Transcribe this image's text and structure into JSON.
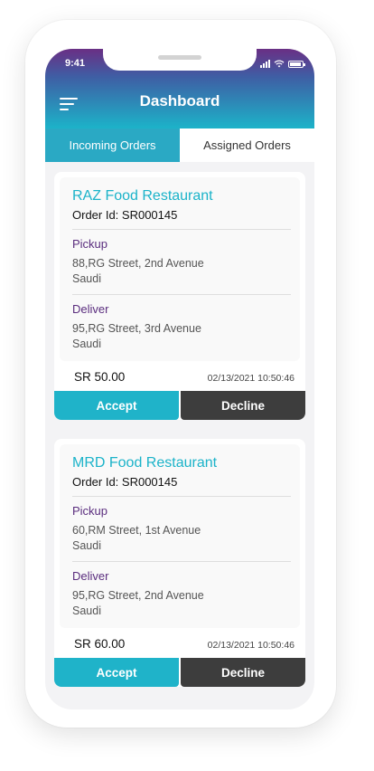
{
  "status_bar": {
    "time": "9:41"
  },
  "header": {
    "title": "Dashboard"
  },
  "tabs": [
    {
      "label": "Incoming Orders",
      "active": true
    },
    {
      "label": "Assigned Orders",
      "active": false
    }
  ],
  "orders": [
    {
      "restaurant": "RAZ Food Restaurant",
      "order_id": "Order Id: SR000145",
      "pickup_label": "Pickup",
      "pickup_line1": "88,RG Street, 2nd Avenue",
      "pickup_line2": "Saudi",
      "deliver_label": "Deliver",
      "deliver_line1": "95,RG Street, 3rd Avenue",
      "deliver_line2": "Saudi",
      "price": "SR 50.00",
      "datetime": "02/13/2021  10:50:46",
      "accept_label": "Accept",
      "decline_label": "Decline"
    },
    {
      "restaurant": "MRD Food Restaurant",
      "order_id": "Order Id: SR000145",
      "pickup_label": "Pickup",
      "pickup_line1": "60,RM Street, 1st Avenue",
      "pickup_line2": "Saudi",
      "deliver_label": "Deliver",
      "deliver_line1": "95,RG Street, 2nd Avenue",
      "deliver_line2": "Saudi",
      "price": "SR 60.00",
      "datetime": "02/13/2021  10:50:46",
      "accept_label": "Accept",
      "decline_label": "Decline"
    }
  ],
  "colors": {
    "accent": "#1fb3c9",
    "header_top": "#6a2f84",
    "section_label": "#5a2d7e",
    "decline": "#3d3d3d"
  }
}
